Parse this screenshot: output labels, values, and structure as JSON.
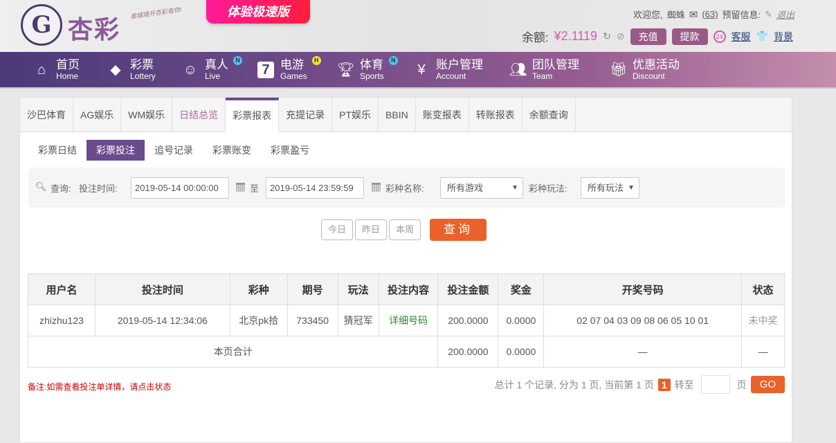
{
  "header": {
    "logo_text": "杏彩",
    "slogan": "泰城境开杏彩有你!",
    "speed_label": "体验极速版",
    "welcome": "欢迎您,",
    "username": "蜘蛛",
    "mail_count": "(63)",
    "reserved_info": "预留信息:",
    "logout": "退出",
    "balance_label": "余额:",
    "balance_value": "¥2.1119",
    "deposit": "充值",
    "withdraw": "提款",
    "support": "客服",
    "background": "背景"
  },
  "nav": [
    {
      "cn": "首页",
      "en": "Home",
      "icon": "home-icon"
    },
    {
      "cn": "彩票",
      "en": "Lottery",
      "icon": "ticket-icon"
    },
    {
      "cn": "真人",
      "en": "Live",
      "icon": "person-icon",
      "badge": "N"
    },
    {
      "cn": "电游",
      "en": "Games",
      "icon": "seven-icon",
      "badge": "H"
    },
    {
      "cn": "体育",
      "en": "Sports",
      "icon": "trophy-icon",
      "badge": "N"
    },
    {
      "cn": "账户管理",
      "en": "Account",
      "icon": "yen-icon"
    },
    {
      "cn": "团队管理",
      "en": "Team",
      "icon": "team-icon"
    },
    {
      "cn": "优惠活动",
      "en": "Discount",
      "icon": "gift-icon"
    }
  ],
  "tabs": [
    "沙巴体育",
    "AG娱乐",
    "WM娱乐",
    "日结总览",
    "彩票报表",
    "充提记录",
    "PT娱乐",
    "BBIN",
    "账变报表",
    "转账报表",
    "余额查询"
  ],
  "subtabs": [
    "彩票日结",
    "彩票投注",
    "追号记录",
    "彩票账变",
    "彩票盈亏"
  ],
  "filter": {
    "query": "查询:",
    "time_label": "投注时间:",
    "start": "2019-05-14 00:00:00",
    "to": "至",
    "end": "2019-05-14 23:59:59",
    "name_label": "彩种名称:",
    "name_value": "所有游戏",
    "play_label": "彩种玩法:",
    "play_value": "所有玩法"
  },
  "quick": {
    "today": "今日",
    "yesterday": "昨日",
    "week": "本周",
    "search": "查询"
  },
  "table": {
    "headers": [
      "用户名",
      "投注时间",
      "彩种",
      "期号",
      "玩法",
      "投注内容",
      "投注金额",
      "奖金",
      "开奖号码",
      "状态"
    ],
    "row": [
      "zhizhu123",
      "2019-05-14 12:34:06",
      "北京pk拾",
      "733450",
      "猜冠军",
      "详细号码",
      "200.0000",
      "0.0000",
      "02 07 04 03 09 08 06 05 10 01",
      "未中奖"
    ],
    "total": {
      "label": "本页合计",
      "amount": "200.0000",
      "bonus": "0.0000",
      "numbers": "—",
      "status": "—"
    }
  },
  "note": "备注:如需查看投注单详情，请点击状态",
  "pager": {
    "summary": "总计 1 个记录, 分为 1 页, 当前第 1 页",
    "current": "1",
    "goto": "转至",
    "page": "页",
    "go": "GO"
  }
}
